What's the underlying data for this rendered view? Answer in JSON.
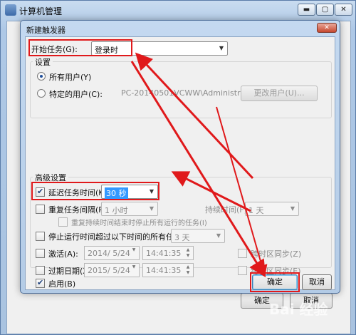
{
  "bg_window": {
    "title": "计算机管理",
    "controls": {
      "minimize": "▬",
      "maximize": "▢",
      "close": "✕"
    },
    "strip_buttons": {
      "confirm": "确定",
      "cancel": "取消"
    }
  },
  "dialog": {
    "title": "新建触发器",
    "close_glyph": "✕",
    "start_task": {
      "label": "开始任务(G):",
      "value": "登录时"
    },
    "settings": {
      "heading": "设置",
      "all_users": "所有用户(Y)",
      "specific_user": "特定的用户(C):",
      "user_path": "PC-20140501VCWW\\Administrator",
      "change_user_button": "更改用户(U)..."
    },
    "advanced": {
      "heading": "高级设置",
      "delay_label": "延迟任务时间(K):",
      "delay_value": "30 秒",
      "repeat_label": "重复任务间隔(P):",
      "repeat_value": "1 小时",
      "duration_label": "持续时间(F):",
      "duration_value": "1 天",
      "stop_repeat_label": "重复持续时间结束时停止所有运行的任务(I)",
      "stop_longer_label": "停止运行时间超过以下时间的所有任务(L):",
      "stop_longer_value": "3 天",
      "activate_label": "激活(A):",
      "activate_date": "2014/ 5/24",
      "activate_time": "14:41:35",
      "sync_tz_label_1": "跨时区同步(Z)",
      "expire_label": "过期日期(X):",
      "expire_date": "2015/ 5/24",
      "expire_time": "14:41:35",
      "sync_tz_label_2": "跨时区同步(E)",
      "enabled_label": "启用(B)"
    },
    "buttons": {
      "ok": "确定",
      "cancel": "取消"
    }
  },
  "watermark": "Bai 经验",
  "annotation_color": "#e0191b"
}
